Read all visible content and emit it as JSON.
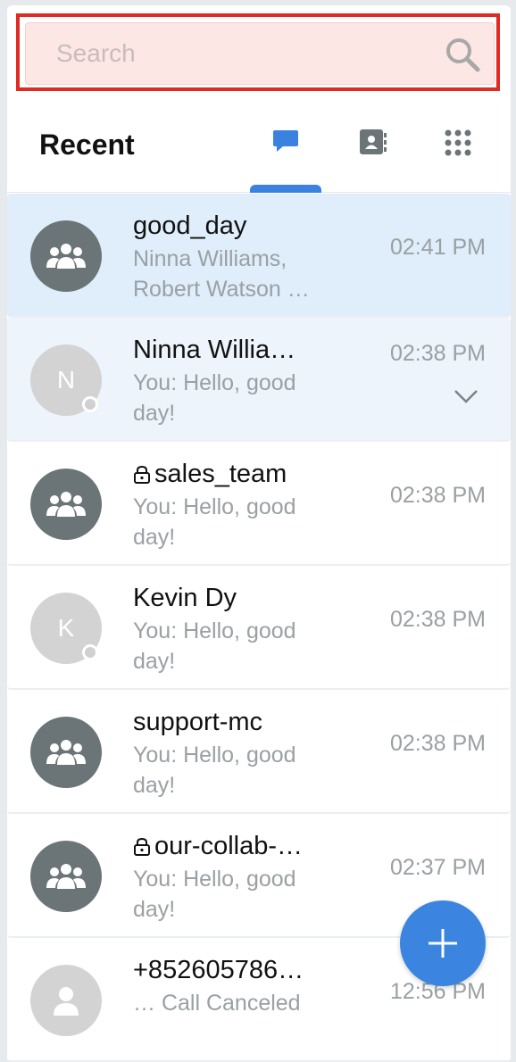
{
  "search": {
    "placeholder": "Search"
  },
  "header": {
    "title": "Recent"
  },
  "tabs": [
    {
      "name": "chats",
      "icon": "chat-bubble-icon",
      "active": true
    },
    {
      "name": "contacts",
      "icon": "contact-book-icon",
      "active": false
    },
    {
      "name": "dialpad",
      "icon": "dialpad-grid-icon",
      "active": false
    }
  ],
  "conversations": [
    {
      "name": "good_day",
      "preview_line1": "Ninna Williams,",
      "preview_line2": "Robert Watson …",
      "time": "02:41 PM",
      "avatar": "group",
      "locked": false,
      "state": "selected"
    },
    {
      "name": "Ninna Willia…",
      "preview_line1": "You: Hello, good",
      "preview_line2": "day!",
      "time": "02:38 PM",
      "avatar": "N",
      "locked": false,
      "state": "hover"
    },
    {
      "name": "sales_team",
      "preview_line1": "You: Hello, good",
      "preview_line2": "day!",
      "time": "02:38 PM",
      "avatar": "group",
      "locked": true,
      "state": "normal"
    },
    {
      "name": "Kevin Dy",
      "preview_line1": "You: Hello, good",
      "preview_line2": "day!",
      "time": "02:38 PM",
      "avatar": "K",
      "locked": false,
      "state": "normal"
    },
    {
      "name": "support-mc",
      "preview_line1": "You: Hello, good",
      "preview_line2": "day!",
      "time": "02:38 PM",
      "avatar": "group",
      "locked": false,
      "state": "normal"
    },
    {
      "name": "our-collab-…",
      "preview_line1": "You: Hello, good",
      "preview_line2": "day!",
      "time": "02:37 PM",
      "avatar": "group",
      "locked": true,
      "state": "normal"
    },
    {
      "name": "+852605786…",
      "preview_line1": "… Call Canceled",
      "preview_line2": "",
      "time": "12:56 PM",
      "avatar": "person",
      "locked": false,
      "state": "normal"
    }
  ],
  "fab": {
    "icon": "plus-icon"
  },
  "colors": {
    "accent": "#3b85e1",
    "selected_row": "#dfeefa",
    "search_highlight": "#e02a22"
  }
}
